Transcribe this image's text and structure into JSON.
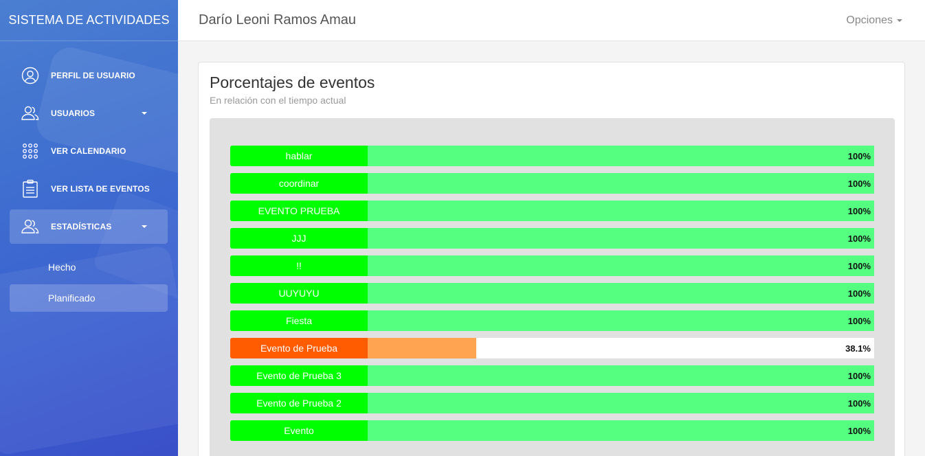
{
  "brand": "SISTEMA DE ACTIVIDADES",
  "user_name": "Darío Leoni Ramos Amau",
  "options_label": "Opciones",
  "sidebar": {
    "items": [
      {
        "label": "PERFIL DE USUARIO",
        "icon": "user-circle-icon"
      },
      {
        "label": "USUARIOS",
        "icon": "users-icon"
      },
      {
        "label": "VER CALENDARIO",
        "icon": "grid-dots-icon"
      },
      {
        "label": "VER LISTA DE EVENTOS",
        "icon": "clipboard-icon"
      },
      {
        "label": "ESTADÍSTICAS",
        "icon": "users-icon"
      }
    ],
    "subitems": [
      {
        "label": "Hecho"
      },
      {
        "label": "Planificado"
      }
    ]
  },
  "card": {
    "title": "Porcentajes de eventos",
    "subtitle": "En relación con el tiempo actual"
  },
  "colors": {
    "complete_label": "#00ff00",
    "complete_fill": "#55ff7f",
    "partial_label": "#ff5b00",
    "partial_fill": "#ffa552"
  },
  "events": [
    {
      "name": "hablar",
      "percent": 100,
      "percent_text": "100%"
    },
    {
      "name": "coordinar",
      "percent": 100,
      "percent_text": "100%"
    },
    {
      "name": "EVENTO PRUEBA",
      "percent": 100,
      "percent_text": "100%"
    },
    {
      "name": "JJJ",
      "percent": 100,
      "percent_text": "100%"
    },
    {
      "name": "!!",
      "percent": 100,
      "percent_text": "100%"
    },
    {
      "name": "UUYUYU",
      "percent": 100,
      "percent_text": "100%"
    },
    {
      "name": "Fiesta",
      "percent": 100,
      "percent_text": "100%"
    },
    {
      "name": "Evento de Prueba",
      "percent": 21.5,
      "percent_text": "38.1%"
    },
    {
      "name": "Evento de Prueba 3",
      "percent": 100,
      "percent_text": "100%"
    },
    {
      "name": "Evento de Prueba 2",
      "percent": 100,
      "percent_text": "100%"
    },
    {
      "name": "Evento",
      "percent": 100,
      "percent_text": "100%"
    }
  ]
}
